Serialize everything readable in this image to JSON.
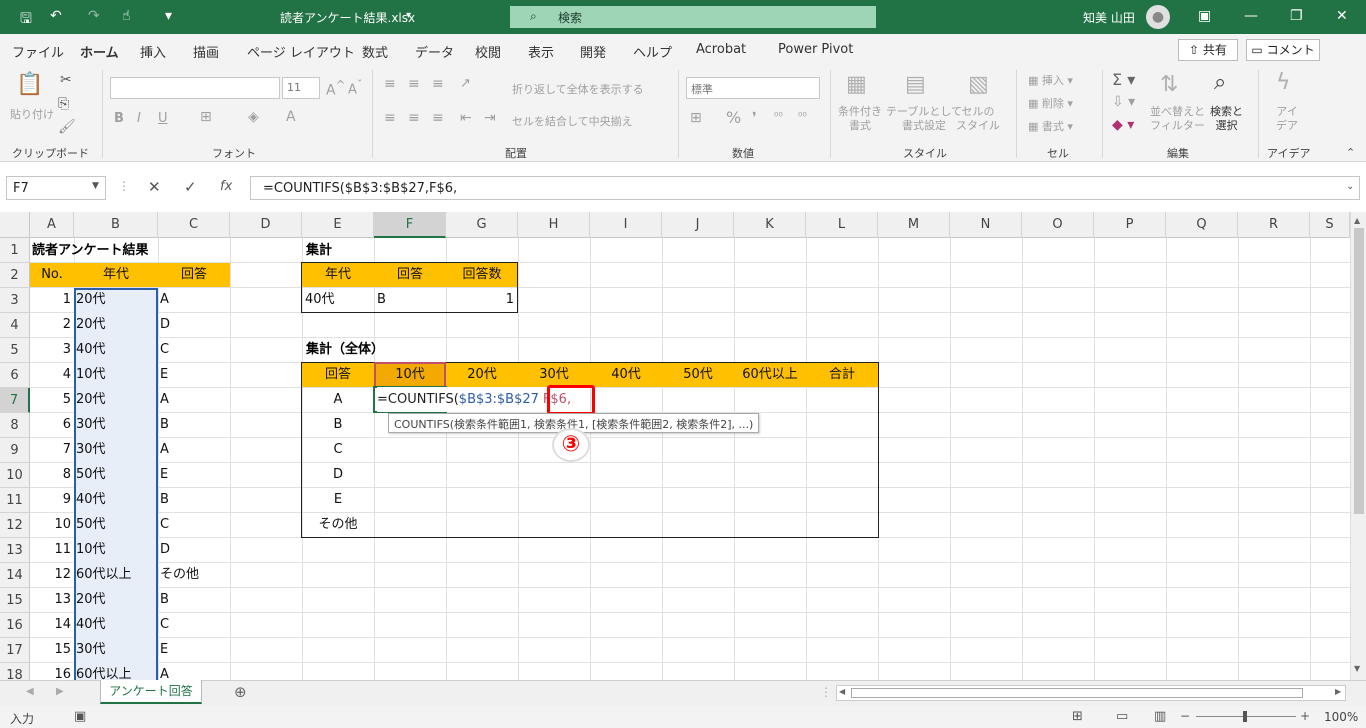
{
  "titlebar": {
    "filename": "読者アンケート結果.xlsx",
    "search_placeholder": "検索",
    "user_name": "知美 山田"
  },
  "menu": {
    "tabs": [
      "ファイル",
      "ホーム",
      "挿入",
      "描画",
      "ページ レイアウト",
      "数式",
      "データ",
      "校閲",
      "表示",
      "開発",
      "ヘルプ",
      "Acrobat",
      "Power Pivot"
    ],
    "active": "ホーム",
    "share": "共有",
    "comment": "コメント"
  },
  "ribbon": {
    "paste": "貼り付け",
    "clipboard_label": "クリップボード",
    "font_size": "11",
    "font_label": "フォント",
    "wrap_text": "折り返して全体を表示する",
    "merge_center": "セルを結合して中央揃え",
    "alignment_label": "配置",
    "number_format": "標準",
    "number_label": "数値",
    "cond_format": "条件付き\n書式",
    "table_format": "テーブルとして\n書式設定",
    "cell_style": "セルの\nスタイル",
    "style_label": "スタイル",
    "insert": "挿入",
    "delete": "削除",
    "format": "書式",
    "cells_label": "セル",
    "sort_filter": "並べ替えと\nフィルター",
    "find_select": "検索と\n選択",
    "editing_label": "編集",
    "ideas": "アイ\nデア",
    "ideas_label": "アイデア"
  },
  "formula_bar": {
    "name_box": "F7",
    "formula": "=COUNTIFS($B$3:$B$27,F$6,"
  },
  "columns": [
    "A",
    "B",
    "C",
    "D",
    "E",
    "F",
    "G",
    "H",
    "I",
    "J",
    "K",
    "L",
    "M",
    "N",
    "O",
    "P",
    "Q",
    "R",
    "S"
  ],
  "rows": [
    "1",
    "2",
    "3",
    "4",
    "5",
    "6",
    "7",
    "8",
    "9",
    "10",
    "11",
    "12",
    "13",
    "14",
    "15",
    "16",
    "17",
    "18"
  ],
  "sheet": {
    "A1": "読者アンケート結果",
    "headers_left": [
      "No.",
      "年代",
      "回答"
    ],
    "survey": [
      [
        "1",
        "20代",
        "A"
      ],
      [
        "2",
        "20代",
        "D"
      ],
      [
        "3",
        "40代",
        "C"
      ],
      [
        "4",
        "10代",
        "E"
      ],
      [
        "5",
        "20代",
        "A"
      ],
      [
        "6",
        "30代",
        "B"
      ],
      [
        "7",
        "30代",
        "A"
      ],
      [
        "8",
        "50代",
        "E"
      ],
      [
        "9",
        "40代",
        "B"
      ],
      [
        "10",
        "50代",
        "C"
      ],
      [
        "11",
        "10代",
        "D"
      ],
      [
        "12",
        "60代以上",
        "その他"
      ],
      [
        "13",
        "20代",
        "B"
      ],
      [
        "14",
        "40代",
        "C"
      ],
      [
        "15",
        "30代",
        "E"
      ],
      [
        "16",
        "60代以上",
        "A"
      ]
    ],
    "E1": "集計",
    "summary_headers": [
      "年代",
      "回答",
      "回答数"
    ],
    "summary_row": [
      "40代",
      "B",
      "1"
    ],
    "E5": "集計（全体）",
    "total_headers": [
      "回答",
      "10代",
      "20代",
      "30代",
      "40代",
      "50代",
      "60代以上",
      "合計"
    ],
    "total_rows": [
      "A",
      "B",
      "C",
      "D",
      "E",
      "その他"
    ],
    "edit_formula_prefix": "=COUNTIFS(",
    "edit_formula_range": "$B$3:$B$27",
    "edit_formula_ref": "F$6,",
    "tooltip": "COUNTIFS(検索条件範囲1, 検索条件1, [検索条件範囲2, 検索条件2], ...)",
    "tooltip_bold": "[検索条件範囲2",
    "step_marker": "③"
  },
  "sheet_tab": "アンケート回答",
  "status": {
    "mode": "入力",
    "zoom": "100%"
  },
  "colors": {
    "excel_green": "#217346",
    "header_orange": "#ffc000",
    "highlight_red": "#ff0000"
  }
}
